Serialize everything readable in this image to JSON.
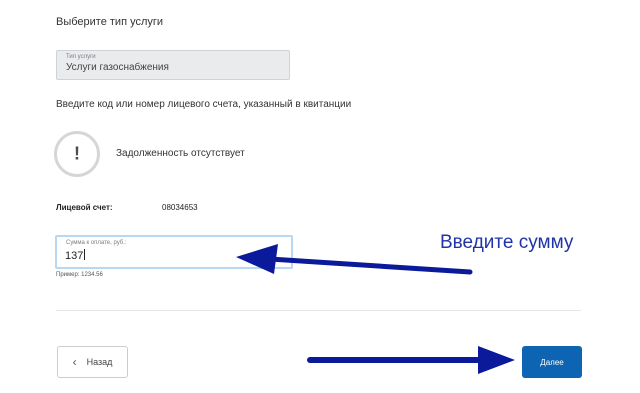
{
  "form": {
    "service_section_title": "Выберите тип услуги",
    "service_field": {
      "label": "Тип услуги",
      "value": "Услуги газоснабжения"
    },
    "account_hint": "Введите код или номер лицевого счета, указанный в квитанции",
    "debt_status": "Задолженность отсутствует",
    "account": {
      "label": "Лицевой счет:",
      "value": "08034653"
    },
    "amount_field": {
      "label": "Сумма к оплате, руб.:",
      "value": "137",
      "example": "Пример: 1234.56"
    },
    "buttons": {
      "back_label": "Назад",
      "next_label": "Далее"
    }
  },
  "annotation": {
    "text": "Введите сумму",
    "color": "#2034a8"
  },
  "colors": {
    "primary_button": "#0c64b2",
    "field_focus_border": "#b8d8f2"
  },
  "icons": {
    "status": "exclamation-icon",
    "back": "chevron-left-icon"
  }
}
